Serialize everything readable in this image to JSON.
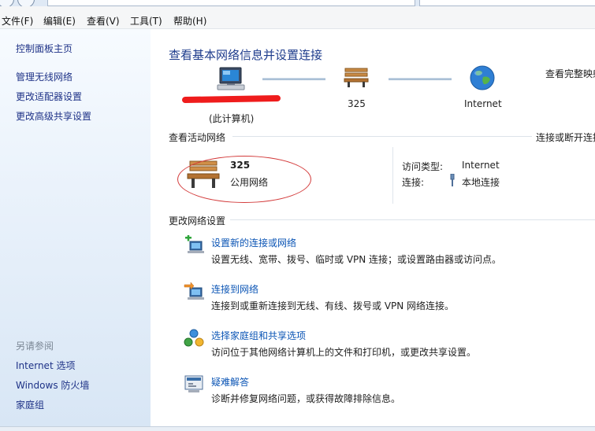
{
  "menu": [
    {
      "label": "文件(F)"
    },
    {
      "label": "编辑(E)"
    },
    {
      "label": "查看(V)"
    },
    {
      "label": "工具(T)"
    },
    {
      "label": "帮助(H)"
    }
  ],
  "sidebar": {
    "items": [
      {
        "label": "控制面板主页"
      },
      {
        "label": "管理无线网络"
      },
      {
        "label": "更改适配器设置"
      },
      {
        "label": "更改高级共享设置"
      }
    ],
    "see_also_heading": "另请参阅",
    "see_also": [
      {
        "label": "Internet 选项"
      },
      {
        "label": "Windows 防火墙"
      },
      {
        "label": "家庭组"
      }
    ]
  },
  "main": {
    "title": "查看基本网络信息并设置连接",
    "view_full_map": "查看完整映射",
    "map": {
      "computer_sub": "(此计算机)",
      "network_name": "325",
      "internet": "Internet"
    },
    "active_section": {
      "label": "查看活动网络",
      "connect_link": "连接或断开连接",
      "network_name": "325",
      "network_type": "公用网络",
      "access_type_label": "访问类型:",
      "access_type_value": "Internet",
      "connection_label": "连接:",
      "connection_value": "本地连接"
    },
    "change_section": {
      "label": "更改网络设置",
      "tasks": [
        {
          "title": "设置新的连接或网络",
          "desc": "设置无线、宽带、拨号、临时或 VPN 连接；或设置路由器或访问点。",
          "icon": "new-connection-icon"
        },
        {
          "title": "连接到网络",
          "desc": "连接到或重新连接到无线、有线、拨号或 VPN 网络连接。",
          "icon": "connect-network-icon"
        },
        {
          "title": "选择家庭组和共享选项",
          "desc": "访问位于其他网络计算机上的文件和打印机，或更改共享设置。",
          "icon": "homegroup-icon"
        },
        {
          "title": "疑难解答",
          "desc": "诊断并修复网络问题，或获得故障排除信息。",
          "icon": "troubleshoot-icon"
        }
      ]
    }
  }
}
